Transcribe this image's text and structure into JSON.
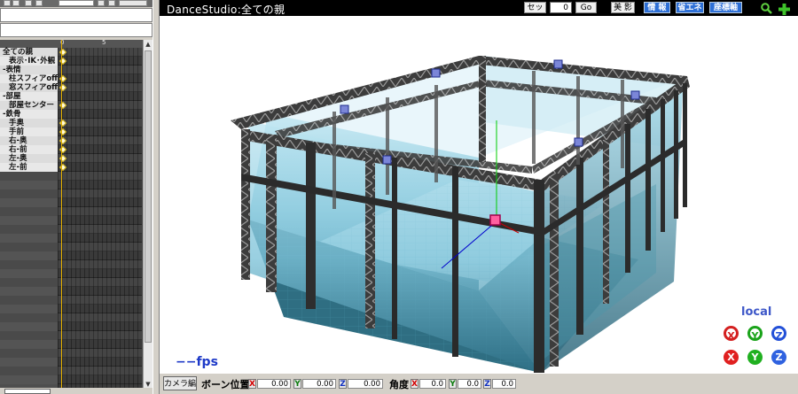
{
  "viewport": {
    "title": "DanceStudio:全ての親",
    "set_label": "セット",
    "frame_value": "0",
    "go_label": "Go",
    "beauty_label": "美 影",
    "info_label": "情 報",
    "energy_label": "省エネ",
    "coord_label": "座標軸",
    "fps_text": "−−fps",
    "local_label": "local",
    "colors": {
      "title_bg": "#000000",
      "accent_blue": "#2d6fd6",
      "fps_blue": "#1e3ac8"
    }
  },
  "timeline": {
    "frame_numbers": [
      "0",
      "5"
    ],
    "rows": [
      {
        "label": "全ての親",
        "indent": false,
        "key": true
      },
      {
        "label": "表示･IK･外観",
        "indent": true,
        "key": true
      },
      {
        "label": "-表情",
        "indent": false,
        "key": false
      },
      {
        "label": "柱スフィアoff",
        "indent": true,
        "key": true
      },
      {
        "label": "窓スフィアoff",
        "indent": true,
        "key": true
      },
      {
        "label": "-部屋",
        "indent": false,
        "key": false
      },
      {
        "label": "部屋センター",
        "indent": true,
        "key": true
      },
      {
        "label": "-鉄骨",
        "indent": false,
        "key": false
      },
      {
        "label": "手奥",
        "indent": true,
        "key": true
      },
      {
        "label": "手前",
        "indent": true,
        "key": true
      },
      {
        "label": "右-奥",
        "indent": true,
        "key": true
      },
      {
        "label": "右-前",
        "indent": true,
        "key": true
      },
      {
        "label": "左-奥",
        "indent": true,
        "key": true
      },
      {
        "label": "左-前",
        "indent": true,
        "key": true
      }
    ]
  },
  "bottom_bar": {
    "camera_edit_label": "カメラ編",
    "bone_position_label": "ボーン位置",
    "angle_label": "角度",
    "x_label": "X",
    "y_label": "Y",
    "z_label": "Z",
    "pos_x": "0.00",
    "pos_y": "0.00",
    "pos_z": "0.00",
    "ang_x": "0.0",
    "ang_y": "0.0",
    "ang_z": "0.0"
  },
  "gizmo": {
    "x_label": "X",
    "y_label": "Y",
    "z_label": "Z"
  }
}
